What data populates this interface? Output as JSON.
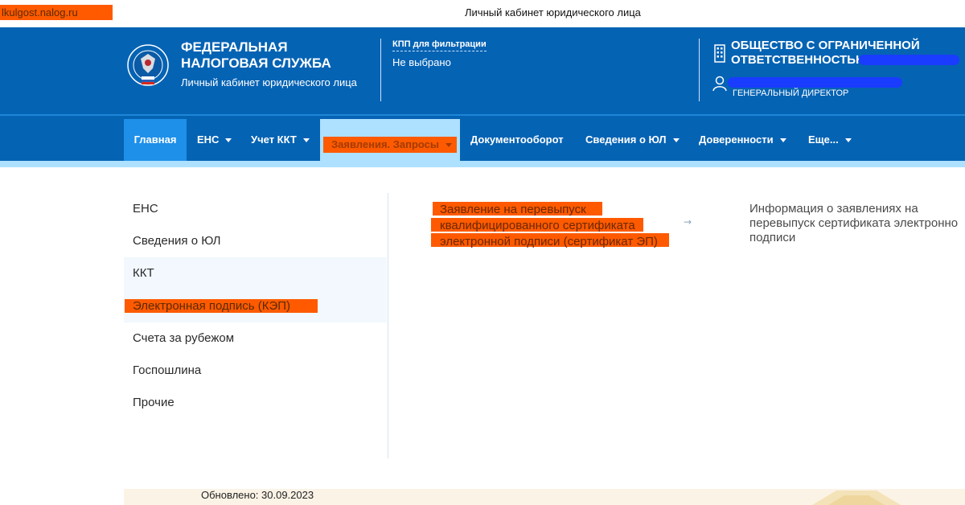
{
  "browser": {
    "url": "lkulgost.nalog.ru",
    "window_title": "Личный кабинет юридического лица"
  },
  "header": {
    "brand_title": "ФЕДЕРАЛЬНАЯ НАЛОГОВАЯ СЛУЖБА",
    "brand_subtitle": "Личный кабинет юридического лица",
    "kpp_label": "КПП для фильтрации",
    "kpp_value": "Не выбрано",
    "org_name": "ОБЩЕСТВО С ОГРАНИЧЕННОЙ ОТВЕТСТВЕННОСТЬЮ",
    "user_role": "ГЕНЕРАЛЬНЫЙ ДИРЕКТОР",
    "colors": {
      "header_bg": "#0563b4",
      "highlight": "#ff5a00",
      "active_tab": "#aee0ff"
    }
  },
  "nav": {
    "items": [
      {
        "label": "Главная",
        "has_caret": false
      },
      {
        "label": "ЕНС",
        "has_caret": true
      },
      {
        "label": "Учет ККТ",
        "has_caret": true
      },
      {
        "label": "Заявления. Запросы",
        "has_caret": true,
        "active": true
      },
      {
        "label": "Документооборот",
        "has_caret": false
      },
      {
        "label": "Сведения о ЮЛ",
        "has_caret": true
      },
      {
        "label": "Доверенности",
        "has_caret": true
      },
      {
        "label": "Еще...",
        "has_caret": true
      }
    ]
  },
  "dropdown": {
    "categories": [
      {
        "label": "ЕНС"
      },
      {
        "label": "Сведения о ЮЛ"
      },
      {
        "label": "ККТ"
      },
      {
        "label": "Электронная подпись (КЭП)",
        "active": true
      },
      {
        "label": "Счета за рубежом"
      },
      {
        "label": "Госпошлина"
      },
      {
        "label": "Прочие"
      }
    ],
    "link_lines": [
      "Заявление на перевыпуск",
      "квалифицированного сертификата",
      "электронной подписи (сертификат ЭП)"
    ],
    "arrow": "→",
    "info_lines": [
      "Информация о заявлениях на",
      "перевыпуск сертификата электронно",
      "подписи"
    ]
  },
  "footer": {
    "updated": "Обновлено: 30.09.2023"
  }
}
